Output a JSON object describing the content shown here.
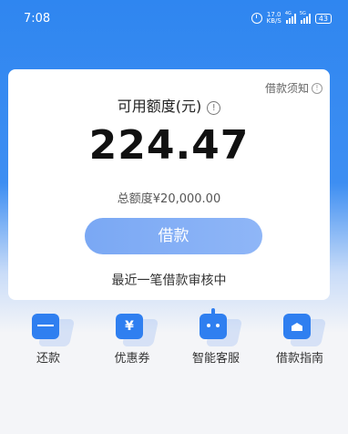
{
  "status_bar": {
    "time": "7:08",
    "net_speed_top": "17.0",
    "net_speed_bottom": "KB/S",
    "sim1_label": "4G",
    "sim2_label": "5G",
    "battery": "43"
  },
  "card": {
    "loan_notice": "借款须知",
    "quota_label": "可用额度(元)",
    "available_amount": "224.47",
    "total_quota": "总额度¥20,000.00",
    "borrow_button": "借款",
    "review_status": "最近一笔借款审核中"
  },
  "actions": [
    {
      "label": "还款",
      "icon": "card-icon"
    },
    {
      "label": "优惠券",
      "icon": "coupon-icon"
    },
    {
      "label": "智能客服",
      "icon": "robot-icon"
    },
    {
      "label": "借款指南",
      "icon": "guide-icon"
    }
  ],
  "colors": {
    "primary": "#2f7ff0",
    "button": "#8fb6f7",
    "background": "#f4f5f8"
  }
}
